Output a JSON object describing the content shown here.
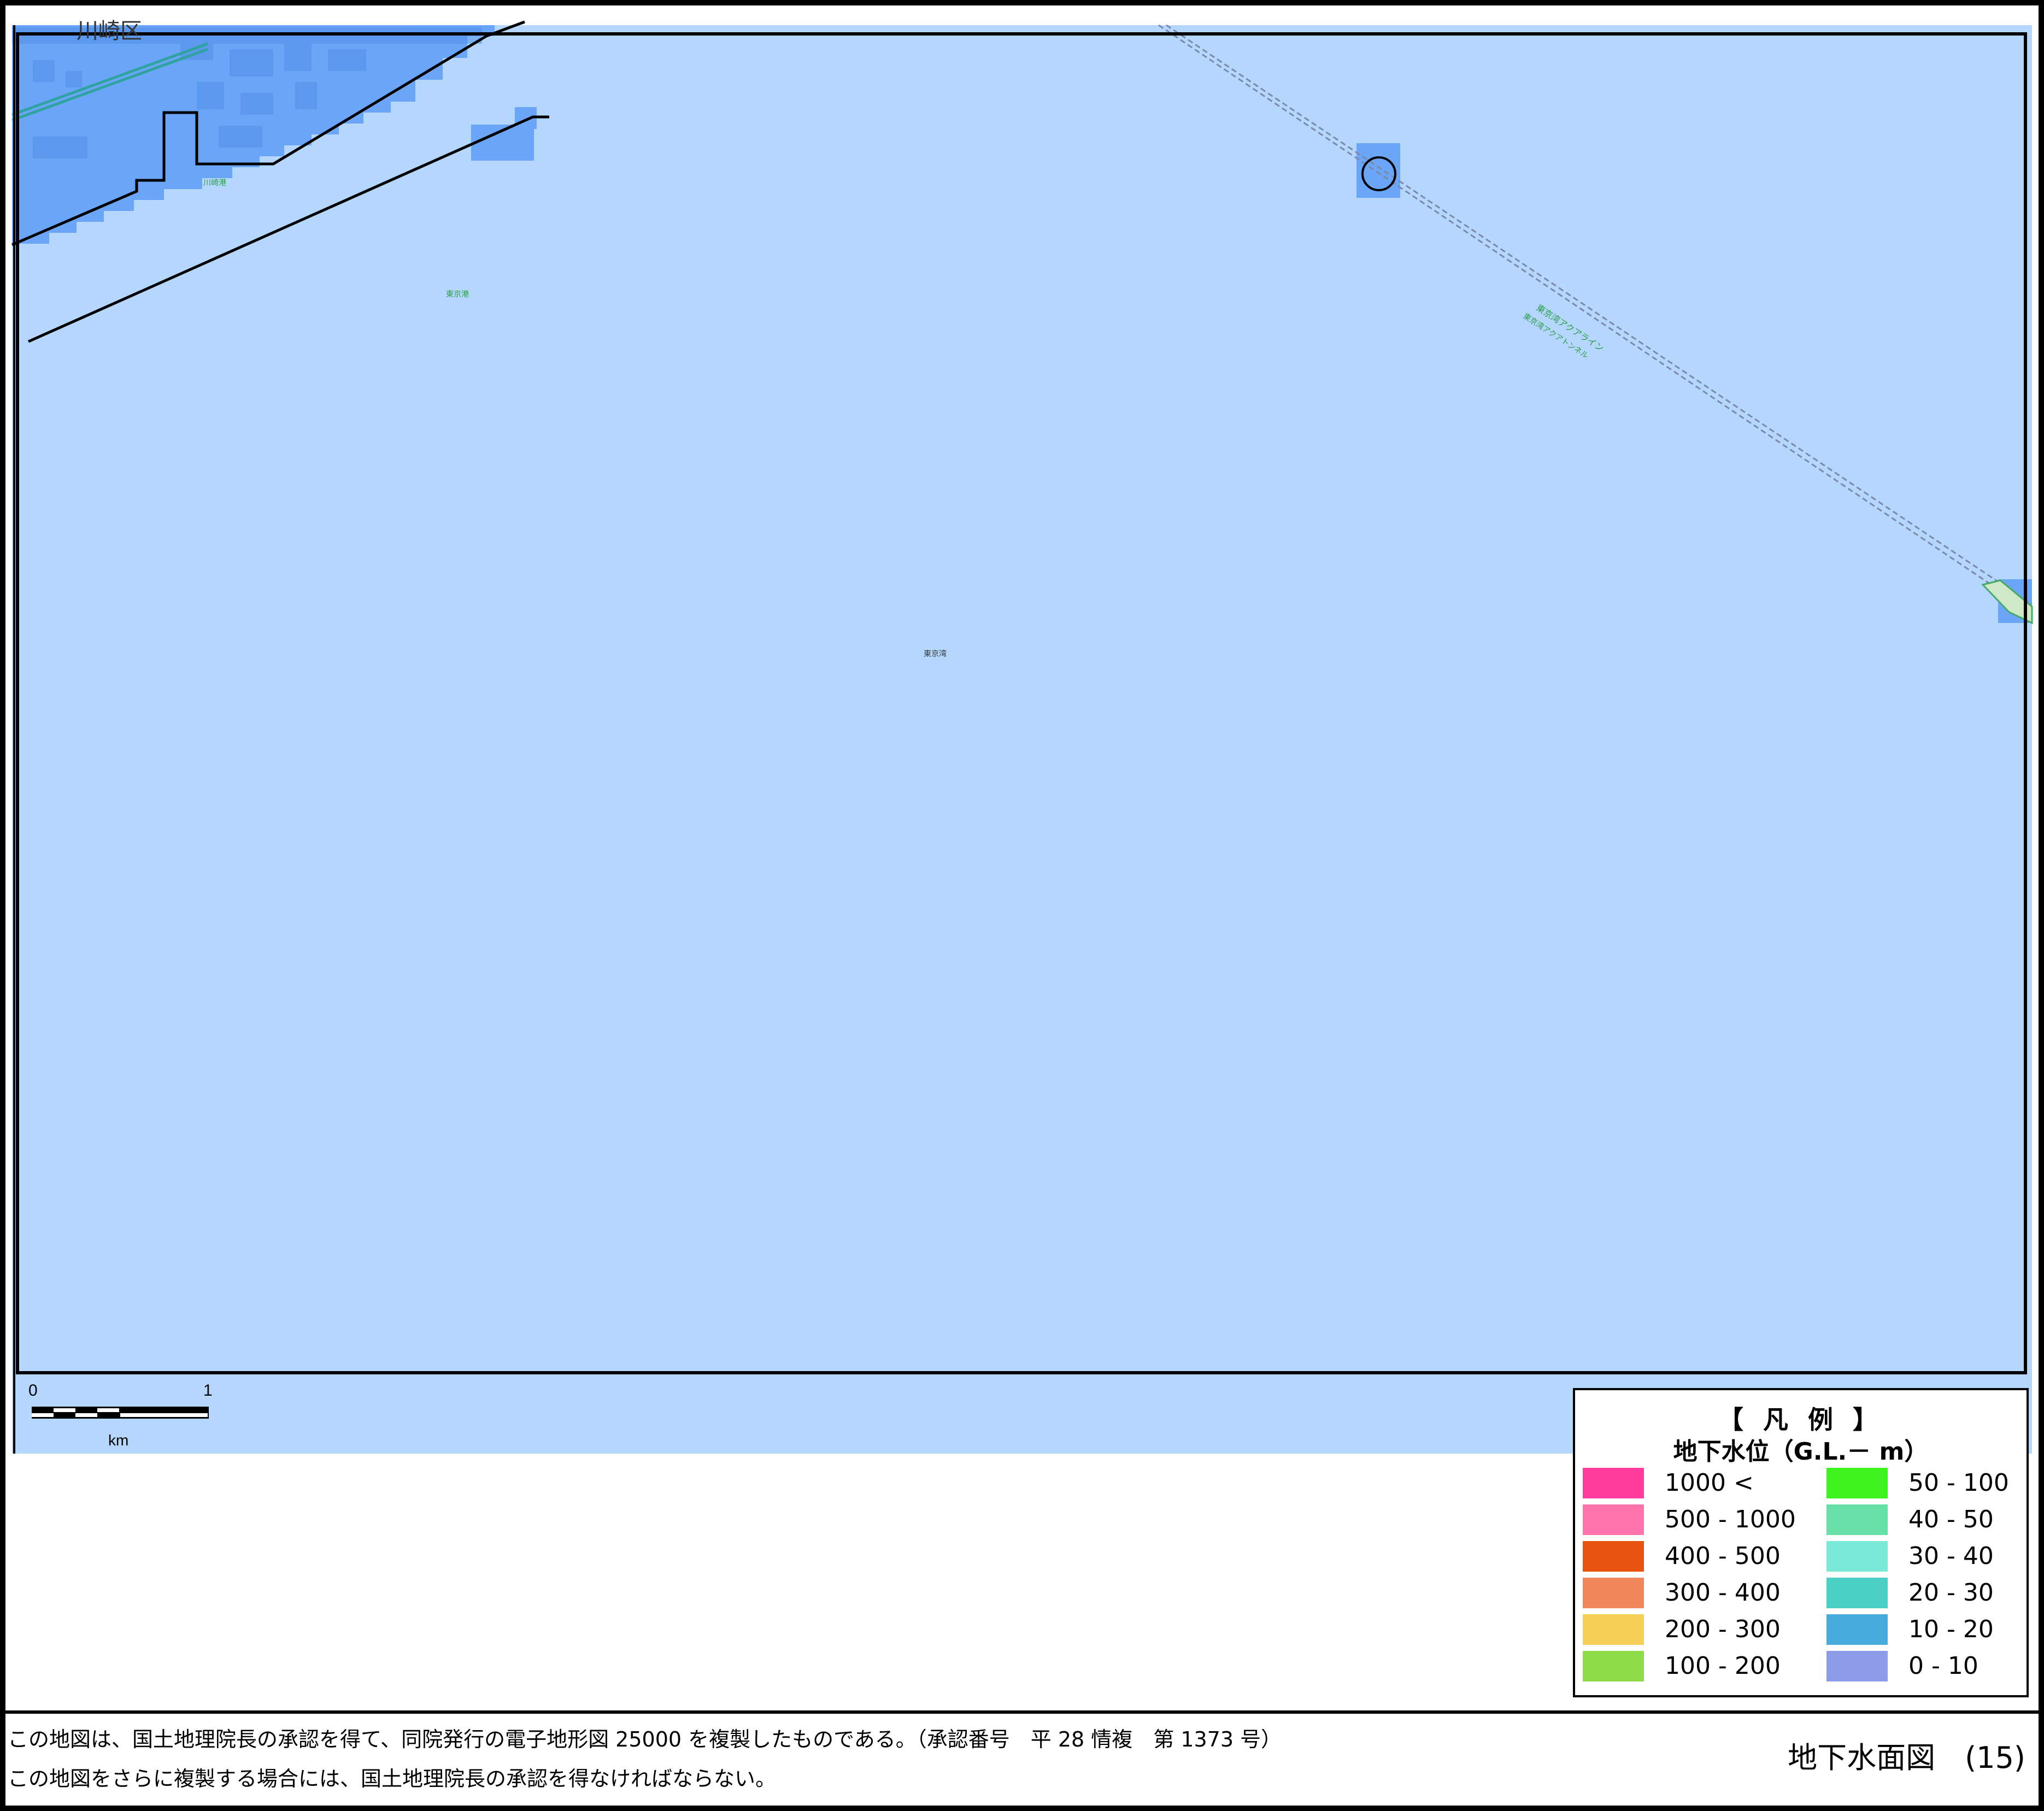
{
  "map": {
    "colors": {
      "water": "#b5d7fd",
      "land_overlay": "#5b9cf7",
      "groundwater_cell": "#6aa5f8"
    },
    "place_labels": {
      "city_partial": "川崎区",
      "port_label_1": "川崎港",
      "port_label_2": "東京港",
      "bay_label": "東京湾",
      "aqualine_1": "東京湾アクアライン",
      "aqualine_2": "東京湾アクアトンネル"
    },
    "scale_bar": {
      "start_label": "0",
      "end_label": "1",
      "unit_label": "km"
    }
  },
  "legend": {
    "title": "【 凡 例 】",
    "subtitle": "地下水位（G.L.－ m）",
    "left_column": [
      {
        "label": "1000 <",
        "color": "#ff3c9b"
      },
      {
        "label": "500 - 1000",
        "color": "#ff74aa"
      },
      {
        "label": "400 - 500",
        "color": "#e8540f"
      },
      {
        "label": "300 - 400",
        "color": "#f0865a"
      },
      {
        "label": "200 - 300",
        "color": "#f4d054"
      },
      {
        "label": "100 - 200",
        "color": "#8ddc48"
      }
    ],
    "right_column": [
      {
        "label": "50 - 100",
        "color": "#3ef41f"
      },
      {
        "label": "40 - 50",
        "color": "#66e0a6"
      },
      {
        "label": "30 - 40",
        "color": "#7ae9d7"
      },
      {
        "label": "20 - 30",
        "color": "#4bd0c6"
      },
      {
        "label": "10 - 20",
        "color": "#47abdd"
      },
      {
        "label": "0 - 10",
        "color": "#8c9ce9"
      }
    ]
  },
  "footer": {
    "note_line_1": "この地図は、国土地理院長の承認を得て、同院発行の電子地形図 25000 を複製したものである。（承認番号　平 28 情複　第 1373 号）",
    "note_line_2": "この地図をさらに複製する場合には、国土地理院長の承認を得なければならない。",
    "sheet_title": "地下水面図　(15)"
  }
}
